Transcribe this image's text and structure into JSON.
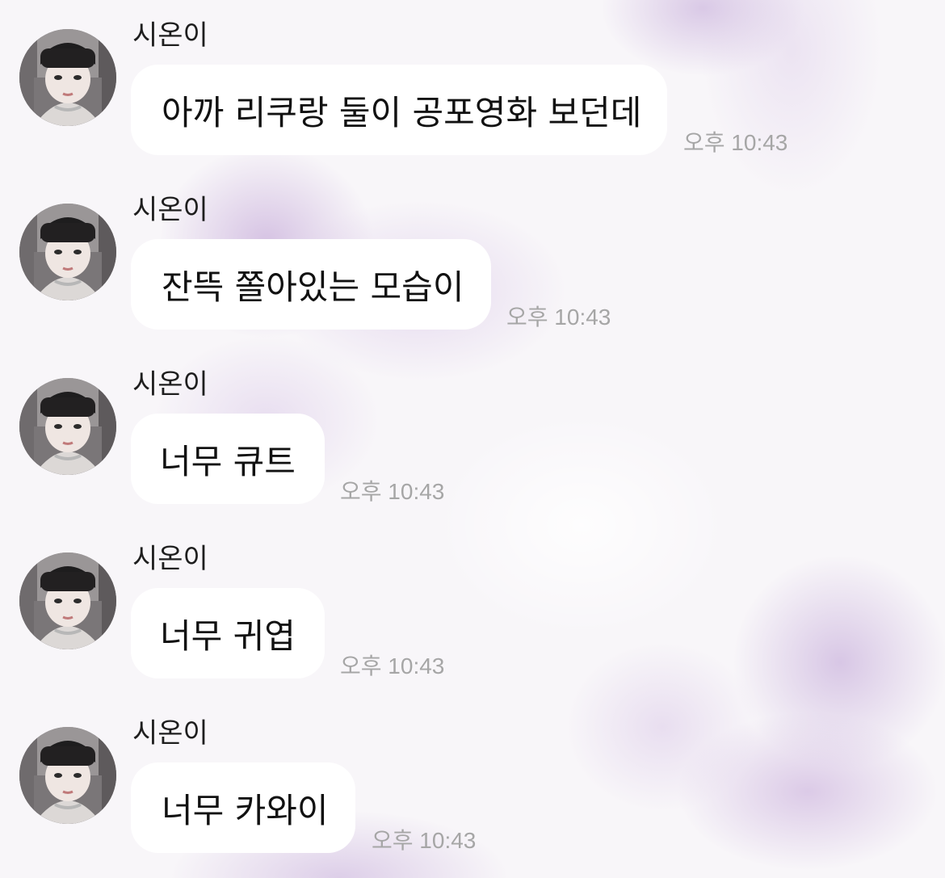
{
  "chat": {
    "messages": [
      {
        "sender": "시온이",
        "text": "아까 리쿠랑 둘이 공포영화 보던데",
        "time": "오후 10:43"
      },
      {
        "sender": "시온이",
        "text": "잔뜩 쫄아있는 모습이",
        "time": "오후 10:43"
      },
      {
        "sender": "시온이",
        "text": "너무 큐트",
        "time": "오후 10:43"
      },
      {
        "sender": "시온이",
        "text": "너무 귀엽",
        "time": "오후 10:43"
      },
      {
        "sender": "시온이",
        "text": "너무 카와이",
        "time": "오후 10:43"
      }
    ]
  },
  "colors": {
    "background_tint": "#dccbe6",
    "bubble": "#ffffff",
    "timestamp": "#a6a6a6",
    "text": "#111111"
  },
  "icons": {
    "avatar": "profile-photo"
  }
}
